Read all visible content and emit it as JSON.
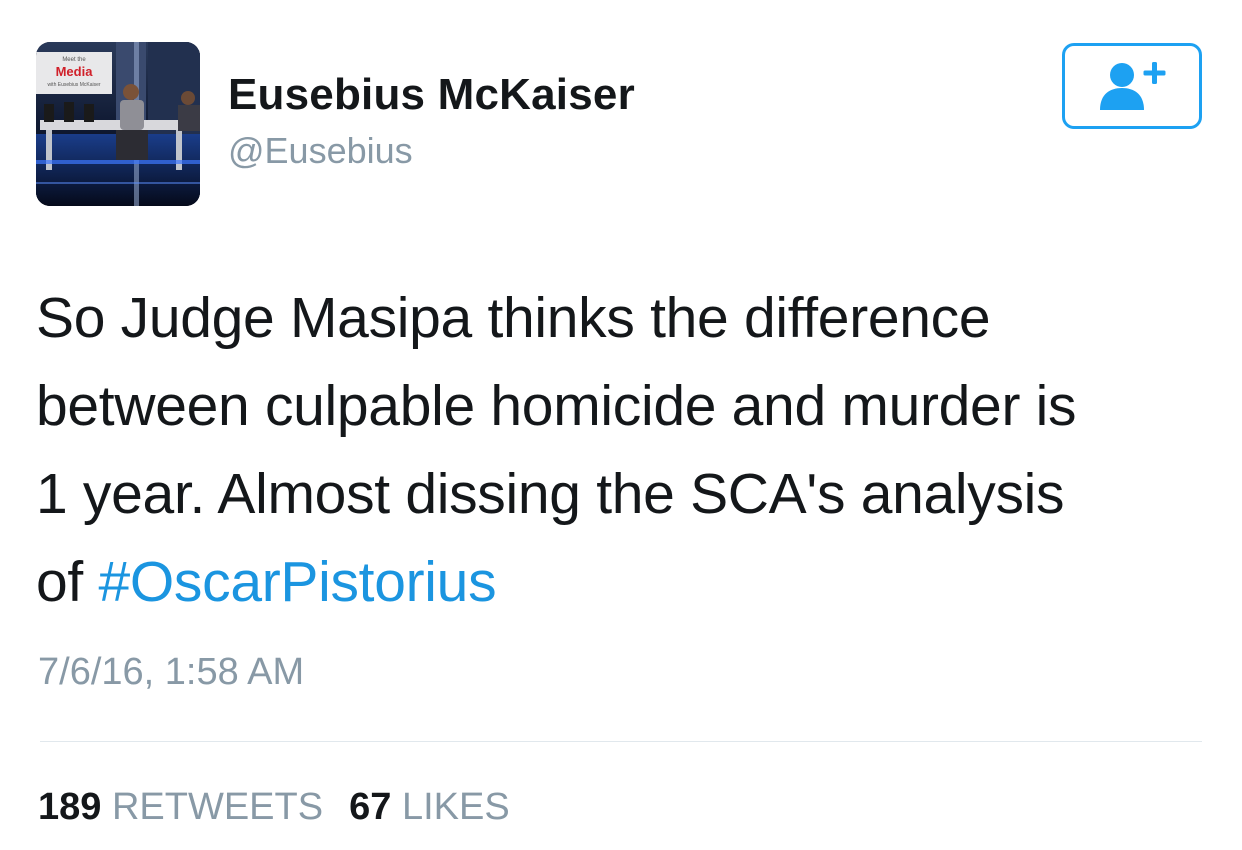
{
  "author": {
    "name": "Eusebius McKaiser",
    "handle": "@Eusebius",
    "avatar_text": [
      "Meet the",
      "Media",
      "with Eusebius McKaiser"
    ]
  },
  "follow_button": {
    "icon": "add-user-icon",
    "color": "#1da1f2"
  },
  "tweet": {
    "lines": [
      "So Judge Masipa thinks the difference",
      "between culpable homicide and murder is",
      "1 year. Almost dissing the SCA's analysis",
      "of "
    ],
    "hashtag": "#OscarPistorius",
    "timestamp": "7/6/16, 1:58 AM"
  },
  "stats": {
    "retweets_count": "189",
    "retweets_label": "RETWEETS",
    "likes_count": "67",
    "likes_label": "LIKES"
  },
  "colors": {
    "link": "#1b95e0",
    "muted": "#8899a6",
    "text": "#14171a",
    "divider": "#e1e8ed"
  }
}
